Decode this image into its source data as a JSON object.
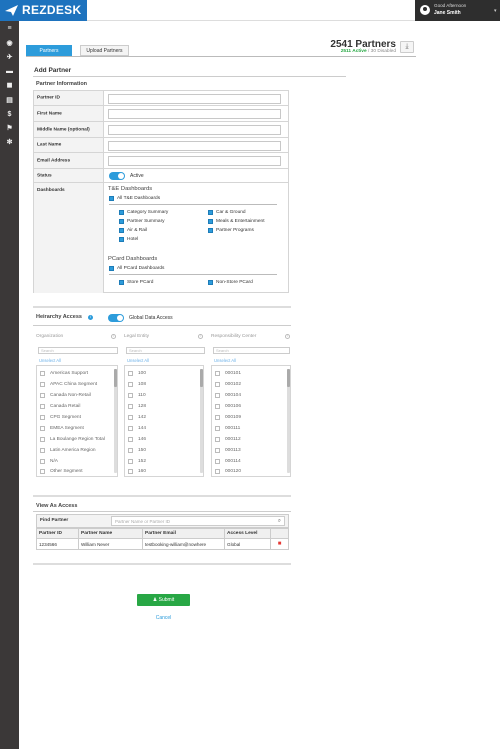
{
  "brand": {
    "name": "REZDESK",
    "color": "#1e73be"
  },
  "user": {
    "greeting": "Good Afternoon",
    "name": "Jane Smith"
  },
  "sidebar": {
    "icons": [
      "menu-icon",
      "dashboard-icon",
      "flight-icon",
      "hotel-icon",
      "car-icon",
      "document-icon",
      "money-icon",
      "flag-icon",
      "settings-icon"
    ]
  },
  "tabs": [
    {
      "label": "Partners",
      "active": true
    },
    {
      "label": "Upload Partners",
      "active": false
    }
  ],
  "summary": {
    "count": "2541 Partners",
    "active": "2511 Active",
    "sep": " / ",
    "disabled": "30 Disabled"
  },
  "page": {
    "title": "Add Partner",
    "section": "Partner Information"
  },
  "form": {
    "fields": [
      {
        "label": "Partner ID",
        "value": ""
      },
      {
        "label": "First Name",
        "value": ""
      },
      {
        "label": "Middle Name (optional)",
        "value": ""
      },
      {
        "label": "Last Name",
        "value": ""
      },
      {
        "label": "Email Address",
        "value": ""
      }
    ],
    "status_label": "Status",
    "status_value": "Active",
    "dashboards_label": "Dashboards",
    "te": {
      "title": "T&E Dashboards",
      "all": "All T&E Dashboards",
      "col1": [
        "Category Summary",
        "Partner Summary",
        "Air & Rail",
        "Hotel"
      ],
      "col2": [
        "Car & Ground",
        "Meals & Entertainment",
        "Partner Programs"
      ]
    },
    "pcard": {
      "title": "PCard Dashboards",
      "all": "All PCard Dashboards",
      "items": [
        "Store PCard",
        "Non-Store PCard"
      ]
    }
  },
  "hierarchy": {
    "title": "Heirarchy Access",
    "global": "Global Data Access",
    "search_placeholder": "Search",
    "unselect": "Unselect All",
    "org": {
      "label": "Organization",
      "items": [
        "Americas Support",
        "APAC China Segment",
        "Canada Non-Retail",
        "Canada Retail",
        "CPG Segment",
        "EMEA Segment",
        "La Boulange Region Total",
        "Latin America Region",
        "N/A",
        "Other Segment"
      ]
    },
    "le": {
      "label": "Legal Entity",
      "items": [
        "100",
        "108",
        "110",
        "128",
        "142",
        "144",
        "146",
        "150",
        "152",
        "160"
      ]
    },
    "rc": {
      "label": "Responsibility Center",
      "items": [
        "000101",
        "000102",
        "000104",
        "000106",
        "000109",
        "000111",
        "000112",
        "000113",
        "000114",
        "000120"
      ]
    }
  },
  "view_as": {
    "title": "View As Access",
    "find_label": "Find Partner",
    "find_placeholder": "Partner Name or Partner ID",
    "headers": [
      "Partner ID",
      "Partner Name",
      "Partner Email",
      "Access Level"
    ],
    "rows": [
      [
        "1234566",
        "William Never",
        "testbooking-william@nowhere",
        "Global"
      ]
    ]
  },
  "actions": {
    "submit": "Submit",
    "cancel": "Cancel"
  }
}
